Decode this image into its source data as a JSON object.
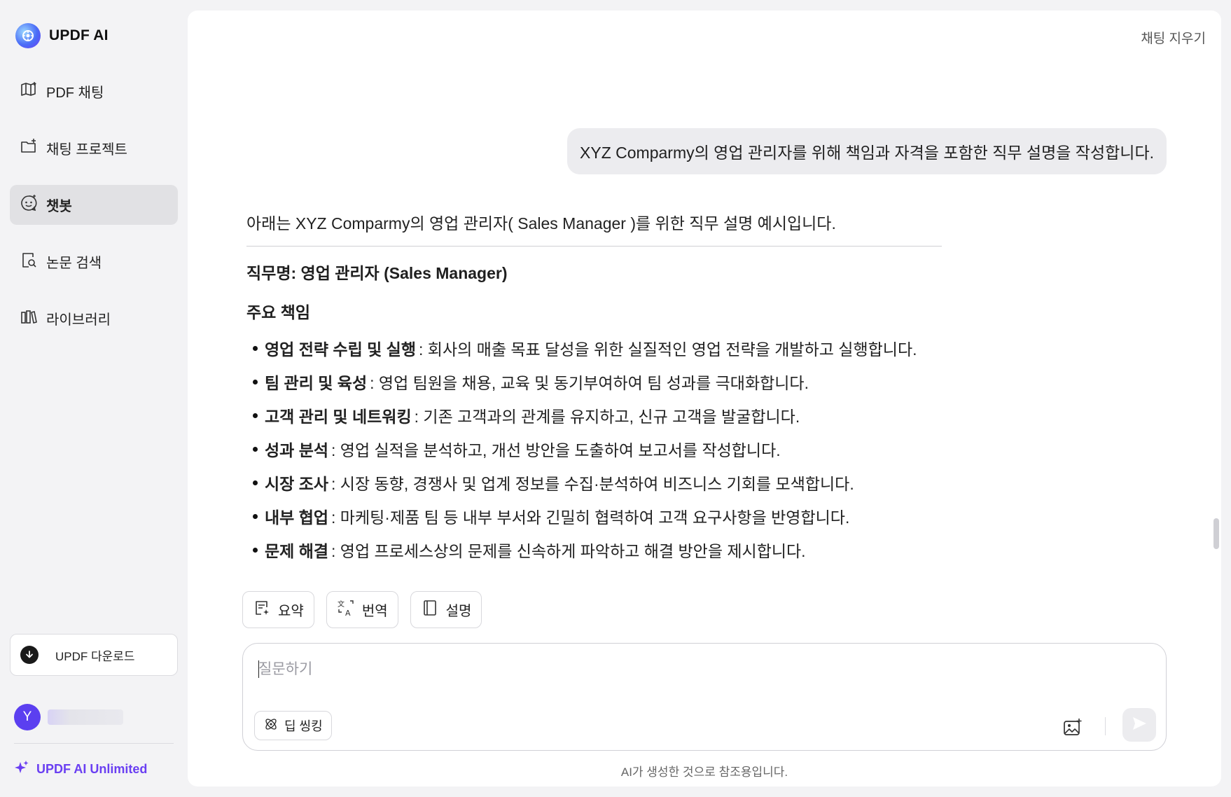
{
  "app": {
    "name": "UPDF AI"
  },
  "sidebar": {
    "items": [
      {
        "label": "PDF 채팅",
        "icon": "book-open-icon"
      },
      {
        "label": "채팅 프로젝트",
        "icon": "folder-plus-icon"
      },
      {
        "label": "챗봇",
        "icon": "chatbot-icon",
        "active": true
      },
      {
        "label": "논문 검색",
        "icon": "search-paper-icon"
      },
      {
        "label": "라이브러리",
        "icon": "library-icon"
      }
    ],
    "download_label": "UPDF 다운로드",
    "user_initial": "Y",
    "unlimited_label": "UPDF AI Unlimited"
  },
  "header": {
    "clear_label": "채팅 지우기"
  },
  "chat": {
    "user_message": "XYZ Comparmy의 영업 관리자를 위해 책임과 자격을 포함한 직무 설명을 작성합니다.",
    "answer": {
      "intro": "아래는 XYZ Comparmy의 영업 관리자( Sales Manager )를 위한 직무 설명 예시입니다.",
      "job_title": "직무명: 영업 관리자 (Sales Manager)",
      "section_heading": "주요 책임",
      "responsibilities": [
        {
          "title": "영업 전략 수립 및 실행",
          "text": ": 회사의 매출 목표 달성을 위한 실질적인 영업 전략을 개발하고 실행합니다."
        },
        {
          "title": "팀 관리 및 육성",
          "text": ": 영업 팀원을 채용, 교육 및 동기부여하여 팀 성과를 극대화합니다."
        },
        {
          "title": "고객 관리 및 네트워킹",
          "text": ": 기존 고객과의 관계를 유지하고, 신규 고객을 발굴합니다."
        },
        {
          "title": "성과 분석",
          "text": ": 영업 실적을 분석하고, 개선 방안을 도출하여 보고서를 작성합니다."
        },
        {
          "title": "시장 조사",
          "text": ": 시장 동향, 경쟁사 및 업계 정보를 수집·분석하여 비즈니스 기회를 모색합니다."
        },
        {
          "title": "내부 협업",
          "text": ": 마케팅·제품 팀 등 내부 부서와 긴밀히 협력하여 고객 요구사항을 반영합니다."
        },
        {
          "title": "문제 해결",
          "text": ": 영업 프로세스상의 문제를 신속하게 파악하고 해결 방안을 제시합니다."
        }
      ]
    }
  },
  "actions": [
    {
      "label": "요약",
      "icon": "summary-icon"
    },
    {
      "label": "번역",
      "icon": "translate-icon"
    },
    {
      "label": "설명",
      "icon": "book-icon"
    }
  ],
  "composer": {
    "placeholder": "질문하기",
    "deep_think_label": "딥 씽킹"
  },
  "footer": {
    "disclaimer": "AI가 생성한 것으로 참조용입니다."
  },
  "colors": {
    "accent": "#6a3ff2",
    "avatar": "#5b3ff0",
    "active_nav": "#e1e1e4"
  }
}
